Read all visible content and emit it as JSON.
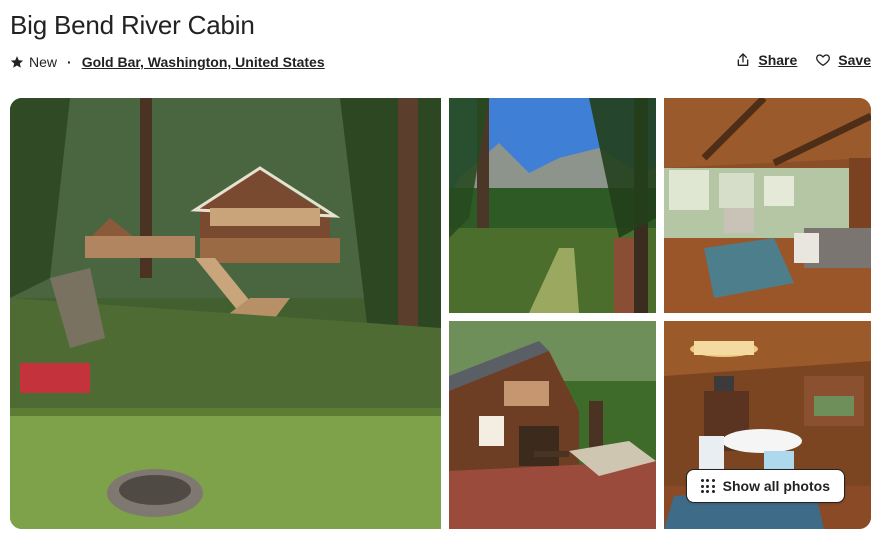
{
  "listing": {
    "title": "Big Bend River Cabin",
    "rating_label": "New",
    "separator": "·",
    "location": "Gold Bar, Washington, United States"
  },
  "actions": {
    "share_label": "Share",
    "save_label": "Save"
  },
  "gallery": {
    "show_all_label": "Show all photos",
    "photos": [
      {
        "subject": "Cabin exterior on hillside with stairs, lawn and fire pit"
      },
      {
        "subject": "Forest trail with mountain view"
      },
      {
        "subject": "Living room with wood ceiling"
      },
      {
        "subject": "Cabin exterior with deck and hot tub"
      },
      {
        "subject": "Dining area with round white table"
      }
    ]
  },
  "icons": {
    "rating": "star-icon",
    "share": "share-icon",
    "save": "heart-icon",
    "show_all": "grid-dots-icon"
  }
}
